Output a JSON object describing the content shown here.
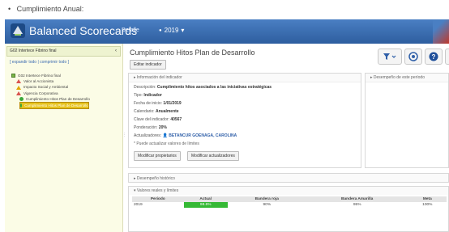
{
  "caption": {
    "bullet": "•",
    "text": "Cumplimiento Anual:"
  },
  "header": {
    "app_title": "Balanced Scorecards",
    "detail_link": "Detalle",
    "year": "2019",
    "year_caret": "▾"
  },
  "sidebar": {
    "selector_label": "G02 Intertece Fibrino final",
    "selector_arrow": "‹",
    "links": "[ expandir todo | comprimir todo ]",
    "tree": [
      {
        "label": "G02 Intertece Fibrino final",
        "icon": "package-icon"
      },
      {
        "label": "Valor al Accionista",
        "icon": "warning-red-icon"
      },
      {
        "label": "Impacto Social y Ambiental",
        "icon": "warning-yellow-icon"
      },
      {
        "label": "Vigencia Corporativa",
        "icon": "warning-red-icon"
      },
      {
        "label": "Cumplimiento Hitos Plan de Desarrollo",
        "icon": "check-circle-icon"
      },
      {
        "label": "Cumplimiento Hitos Plan de Desarrollo",
        "icon": "check-circle-icon",
        "selected": true
      }
    ]
  },
  "main": {
    "title": "Cumplimiento Hitos Plan de Desarrollo",
    "edit_button": "Editar indicador",
    "info_panel": {
      "heading": "▸ Información del indicador",
      "rows": [
        {
          "label": "Descripción:",
          "value": "Cumplimiento hitos asociados a las iniciativas estratégicas"
        },
        {
          "label": "Tipo:",
          "value": "Indicador"
        },
        {
          "label": "Fecha de inicio:",
          "value": "1/01/2019"
        },
        {
          "label": "Calendario:",
          "value": "Anualmente"
        },
        {
          "label": "Clave del indicador:",
          "value": "40567"
        },
        {
          "label": "Ponderación:",
          "value": "20%"
        }
      ],
      "updaters_label": "Actualizadores:",
      "updaters_value": "BETANCUR GOENAGA, CAROLINA",
      "note": "* Puede actualizar valores de límites",
      "btn_modify_owners": "Modificar propietarios",
      "btn_modify_updaters": "Modificar actualizadores"
    },
    "perf_panel_heading": "▸ Desempeño de este período",
    "history_heading": "▸ Desempeño histórico",
    "values_panel": {
      "heading": "▾ Valores reales y límites",
      "columns": [
        "Periodo",
        "Actual",
        "Bandera roja",
        "Bandera Amarilla",
        "Meta"
      ],
      "rows": [
        [
          "2019",
          "98.6%",
          "90%",
          "95%",
          "100%"
        ]
      ]
    }
  },
  "colors": {
    "header_blue": "#2e5e9f",
    "actual_green": "#35b935",
    "selected_yellow": "#e6c21c"
  }
}
